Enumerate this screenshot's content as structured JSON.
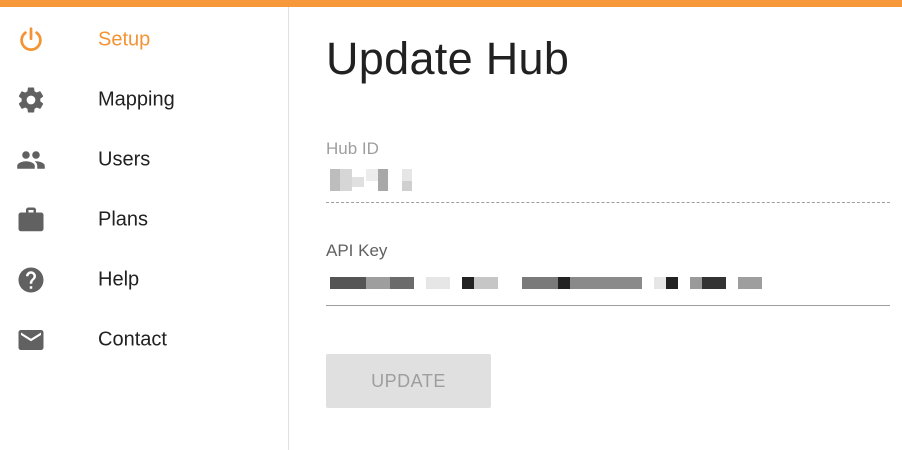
{
  "colors": {
    "accent": "#f7983a",
    "active_label": "#f39334",
    "icon_gray": "#616161"
  },
  "sidebar": {
    "items": [
      {
        "label": "Setup",
        "icon": "power-icon",
        "active": true
      },
      {
        "label": "Mapping",
        "icon": "gear-icon",
        "active": false
      },
      {
        "label": "Users",
        "icon": "people-icon",
        "active": false
      },
      {
        "label": "Plans",
        "icon": "briefcase-icon",
        "active": false
      },
      {
        "label": "Help",
        "icon": "help-icon",
        "active": false
      },
      {
        "label": "Contact",
        "icon": "mail-icon",
        "active": false
      }
    ]
  },
  "main": {
    "title": "Update Hub",
    "hub_id": {
      "label": "Hub ID",
      "value": ""
    },
    "api_key": {
      "label": "API Key",
      "value": ""
    },
    "update_button": "UPDATE"
  }
}
